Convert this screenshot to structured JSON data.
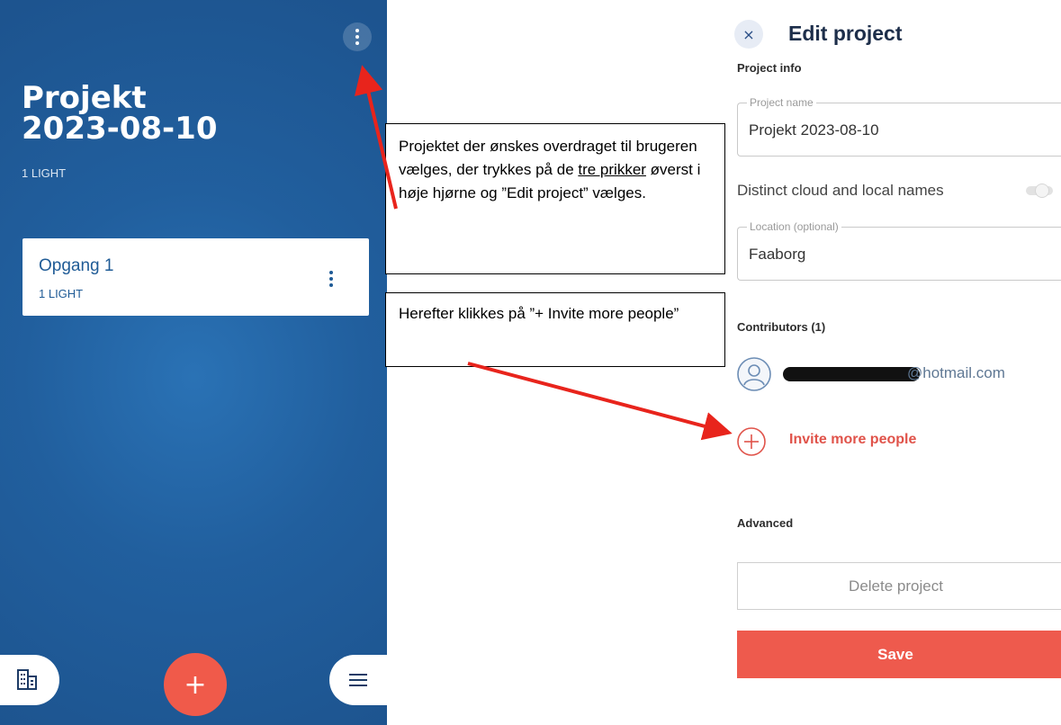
{
  "phone": {
    "project_title_line1": "Projekt",
    "project_title_line2": "2023-08-10",
    "project_light_count": "1 LIGHT",
    "group_card": {
      "title": "Opgang 1",
      "subtitle": "1 LIGHT"
    },
    "add_button_label": "+"
  },
  "annotations": {
    "note1_part1": "Projektet der ønskes overdraget til brugeren vælges, der trykkes på de ",
    "note1_underlined": "tre prikker",
    "note1_part2": " øverst i høje hjørne og ”Edit project” vælges.",
    "note2": "Herefter klikkes på ”+ Invite more people”",
    "arrow_color": "#e8241c"
  },
  "edit_project": {
    "close_label": "×",
    "title": "Edit project",
    "project_info_heading": "Project info",
    "project_name_label": "Project name",
    "project_name_value": "Projekt 2023-08-10",
    "distinct_names_label": "Distinct cloud and local names",
    "distinct_names_enabled": false,
    "location_label": "Location (optional)",
    "location_value": "Faaborg",
    "contributors_heading": "Contributors (1)",
    "contributor_email_visible": "@hotmail.com",
    "invite_label": "Invite more people",
    "advanced_heading": "Advanced",
    "delete_label": "Delete project",
    "save_label": "Save"
  },
  "colors": {
    "phone_blue": "#215f9e",
    "accent_red": "#ee5a4d",
    "invite_red": "#e0534a"
  }
}
